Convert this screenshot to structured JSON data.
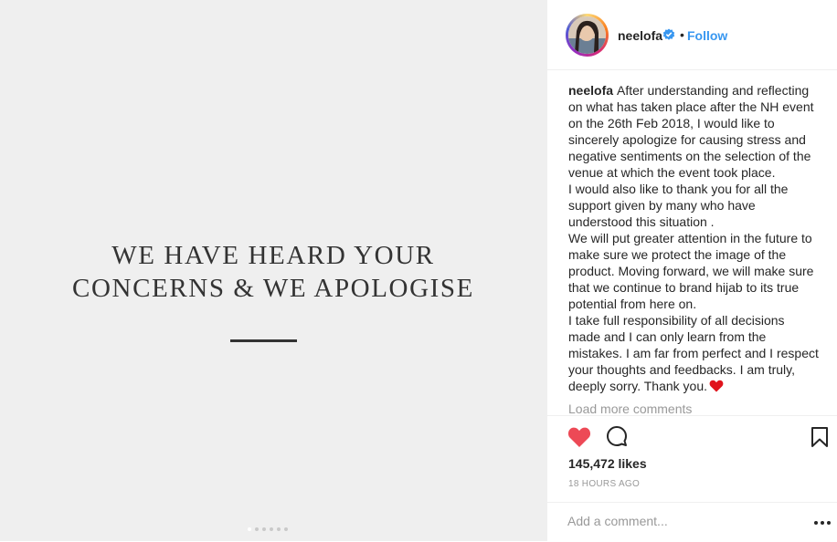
{
  "media": {
    "line1": "WE HAVE HEARD YOUR",
    "line2": "CONCERNS & WE APOLOGISE",
    "carousel_count": 6,
    "carousel_active": 1
  },
  "header": {
    "username": "neelofa",
    "separator": "•",
    "follow_label": "Follow"
  },
  "caption": {
    "username": "neelofa",
    "paragraphs": [
      "After understanding and reflecting on what has taken place after the NH event on the 26th Feb 2018, I would like to sincerely apologize for causing stress and negative sentiments on the selection of the venue at which the event took place.",
      "I would also like to thank you for all the support given by many who have understood this situation .",
      "We will put greater attention in the future to make sure we protect the image of the product. Moving forward, we will make sure that we continue to brand hijab to its true potential from here on.",
      "I take full responsibility of all decisions made and I can only learn from the mistakes. I am far from perfect and I respect your thoughts and feedbacks. I am truly, deeply sorry. Thank you."
    ]
  },
  "load_more": "Load more comments",
  "likes": "145,472 likes",
  "timestamp": "18 HOURS AGO",
  "comment": {
    "placeholder": "Add a comment..."
  },
  "colors": {
    "like": "#ed4956",
    "link": "#3897f0",
    "muted": "#999999",
    "verified": "#3897f0"
  },
  "icons": [
    "heart-icon",
    "comment-icon",
    "bookmark-icon",
    "more-options-icon",
    "verified-badge-icon",
    "red-heart-emoji"
  ]
}
